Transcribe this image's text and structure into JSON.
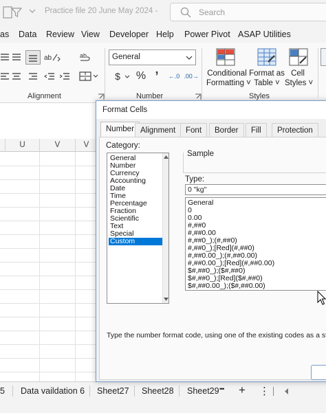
{
  "titlebar": {
    "title": "Practice file 20 June May 2024 -",
    "search_placeholder": "Search"
  },
  "menu": {
    "items": [
      "as",
      "Data",
      "Review",
      "View",
      "Developer",
      "Help",
      "Power Pivot",
      "ASAP Utilities"
    ]
  },
  "ribbon": {
    "number_format_value": "General",
    "groups": {
      "alignment": "Alignment",
      "number": "Number",
      "styles": "Styles"
    },
    "buttons": {
      "conditional_formatting": [
        "Conditional",
        "Formatting ˅"
      ],
      "format_as_table": [
        "Format as",
        "Table ˅"
      ],
      "cell_styles": [
        "Cell",
        "Styles ˅"
      ]
    },
    "number_buttons": {
      "currency": "$",
      "percent": "%",
      "comma": "’",
      "inc_decimal": "←.0",
      "dec_decimal": ".00→"
    }
  },
  "grid": {
    "columns": [
      "U",
      "V",
      "V"
    ]
  },
  "sheets": {
    "tabs": [
      "5",
      "Data vaildation 6",
      "Sheet27",
      "Sheet28",
      "Sheet29"
    ],
    "more": "•••",
    "add": "+",
    "menu": "⋮"
  },
  "dialog": {
    "title": "Format Cells",
    "tabs": [
      "Number",
      "Alignment",
      "Font",
      "Border",
      "Fill",
      "Protection"
    ],
    "active_tab": "Number",
    "category_label": "Category:",
    "categories": [
      "General",
      "Number",
      "Currency",
      "Accounting",
      "Date",
      "Time",
      "Percentage",
      "Fraction",
      "Scientific",
      "Text",
      "Special",
      "Custom"
    ],
    "selected_category": "Custom",
    "sample_label": "Sample",
    "type_label": "Type:",
    "type_value": "0 \"kg\"",
    "formats": [
      "General",
      "0",
      "0.00",
      "#,##0",
      "#,##0.00",
      "#,##0_);(#,##0)",
      "#,##0_);[Red](#,##0)",
      "#,##0.00_);(#,##0.00)",
      "#,##0.00_);[Red](#,##0.00)",
      "$#,##0_);($#,##0)",
      "$#,##0_);[Red]($#,##0)",
      "$#,##0.00_);($#,##0.00)"
    ],
    "hint": "Type the number format code, using one of the existing codes as a starting point."
  },
  "colors": {
    "accent": "#0078d7",
    "dialog_border": "#7a9cc6"
  }
}
